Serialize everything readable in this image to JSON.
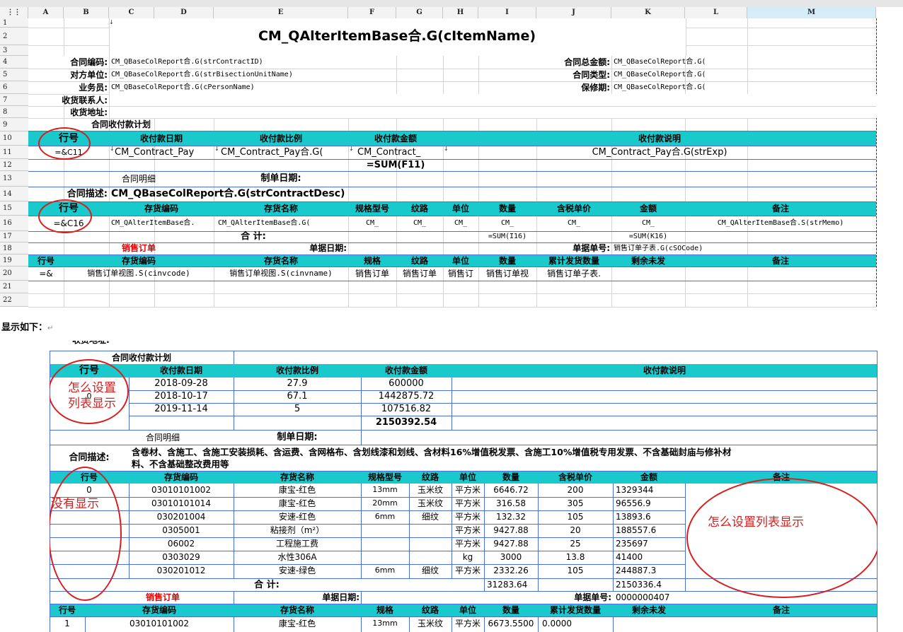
{
  "sheet": {
    "columns": [
      "A",
      "B",
      "C",
      "D",
      "E",
      "F",
      "G",
      "H",
      "I",
      "J",
      "K",
      "L",
      "M"
    ],
    "rows": [
      "1",
      "2",
      "3",
      "4",
      "5",
      "6",
      "7",
      "8",
      "9",
      "10",
      "11",
      "12",
      "13",
      "14",
      "15",
      "16",
      "17",
      "18",
      "19",
      "20",
      "21",
      "22"
    ],
    "title": "CM_QAlterItemBase合.G(cItemName)",
    "r4": {
      "label": "合同编码:",
      "value": "CM_QBaseColReport合.G(strContractID)",
      "label2": "合同总金额:",
      "value2": "CM_QBaseColReport合.G("
    },
    "r5": {
      "label": "对方单位:",
      "value": "CM_QBaseColReport合.G(strBisectionUnitName)",
      "label2": "合同类型:",
      "value2": "CM_QBaseColReport合.G("
    },
    "r6": {
      "label": "业务员:",
      "value": "CM_QBaseColReport合.G(cPersonName)",
      "label2": "保修期:",
      "value2": "CM_QBaseColReport合.G("
    },
    "r7": {
      "label": "收货联系人:"
    },
    "r8": {
      "label": "收货地址:"
    },
    "r9": {
      "label": "合同收付款计划"
    },
    "r10": {
      "c1": "行号",
      "c2": "收付款日期",
      "c3": "收付款比例",
      "c4": "收付款金额",
      "c5": "收付款说明"
    },
    "r11": {
      "c1": "=&C11",
      "c2": "CM_Contract_Pay",
      "c3": "CM_Contract_Pay合.G(",
      "c4": "CM_Contract_",
      "c5": "CM_Contract_Pay合.G(strExp)"
    },
    "r12": {
      "c4": "=SUM(F11)"
    },
    "r13": {
      "c1": "合同明细",
      "c2": "制单日期:"
    },
    "r14": {
      "label": "合同描述:",
      "value": "CM_QBaseColReport合.G(strContractDesc)"
    },
    "r15": {
      "cols": [
        "行号",
        "存货编码",
        "存货名称",
        "规格型号",
        "纹路",
        "单位",
        "数量",
        "含税单价",
        "金额",
        "备注"
      ]
    },
    "r16": {
      "c1": "=&C16",
      "c2": "CM_QAlterItemBase合.",
      "c3": "CM_QAlterItemBase合.G(",
      "c4": "CM_",
      "c5": "CM_",
      "c6": "CM_",
      "c7": "CM_",
      "c8": "CM_",
      "c9": "CM_",
      "c10": "CM_QAlterItemBase合.S(strMemo)"
    },
    "r17": {
      "label": "合 计:",
      "sum1": "=SUM(I16)",
      "sum2": "=SUM(K16)"
    },
    "r18": {
      "label": "销售订单",
      "label2": "单据日期:",
      "label3": "单据单号:",
      "value3": "销售订单子表.G(cSOCode)"
    },
    "r19": {
      "cols": [
        "行号",
        "存货编码",
        "存货名称",
        "规格",
        "纹路",
        "单位",
        "数量",
        "累计发货数量",
        "剩余未发",
        "备注"
      ]
    },
    "r20": {
      "c1": "=&",
      "c2": "销售订单视图.S(cinvcode)",
      "c3": "销售订单视图.S(cinvname)",
      "c4": "销售订单",
      "c5": "销售订单",
      "c6": "销售订",
      "c7": "销售订单视",
      "c8": "销售订单子表."
    }
  },
  "caption": "显示如下：",
  "caption_mark": "↵",
  "result": {
    "top_label": "收货地址:",
    "plan_title": "合同收付款计划",
    "plan_headers": [
      "行号",
      "收付款日期",
      "收付款比例",
      "收付款金额",
      "收付款说明"
    ],
    "plan_rows": [
      {
        "date": "2018-09-28",
        "ratio": "27.9",
        "amount": "600000"
      },
      {
        "date": "2018-10-17",
        "ratio": "67.1",
        "amount": "1442875.72"
      },
      {
        "date": "2019-11-14",
        "ratio": "5",
        "amount": "107516.82"
      }
    ],
    "plan_row_no": "0",
    "plan_total": "2150392.54",
    "detail_label": "合同明细",
    "detail_date_label": "制单日期:",
    "desc_label": "合同描述:",
    "desc_value_1": "含卷材、含施工、含施工安装损耗、含运费、含网格布、含划线漆和划线、含材料16%增值税发票、含施工10%增值税专用发票、不含基础封庙与修补材",
    "desc_value_2": "料、不含基础整改费用等",
    "items_headers": [
      "行号",
      "存货编码",
      "存货名称",
      "规格型号",
      "纹路",
      "单位",
      "数量",
      "含税单价",
      "金额",
      "备注"
    ],
    "items": [
      {
        "no": "0",
        "code": "03010101002",
        "name": "康宝-红色",
        "spec": "13mm",
        "grain": "玉米纹",
        "unit": "平方米",
        "qty": "6646.72",
        "price": "200",
        "amount": "1329344"
      },
      {
        "no": "",
        "code": "03010101014",
        "name": "康宝-红色",
        "spec": "20mm",
        "grain": "玉米纹",
        "unit": "平方米",
        "qty": "316.58",
        "price": "305",
        "amount": "96556.9"
      },
      {
        "no": "",
        "code": "030201004",
        "name": "安速-红色",
        "spec": "6mm",
        "grain": "细纹",
        "unit": "平方米",
        "qty": "132.32",
        "price": "105",
        "amount": "13893.6"
      },
      {
        "no": "",
        "code": "0305001",
        "name": "粘接剂（m²）",
        "spec": "",
        "grain": "",
        "unit": "平方米",
        "qty": "9427.88",
        "price": "20",
        "amount": "188557.6"
      },
      {
        "no": "",
        "code": "06002",
        "name": "工程施工费",
        "spec": "",
        "grain": "",
        "unit": "平方米",
        "qty": "9427.88",
        "price": "25",
        "amount": "235697"
      },
      {
        "no": "",
        "code": "0303029",
        "name": "水性306A",
        "spec": "",
        "grain": "",
        "unit": "kg",
        "qty": "3000",
        "price": "13.8",
        "amount": "41400"
      },
      {
        "no": "",
        "code": "030201012",
        "name": "安速-绿色",
        "spec": "6mm",
        "grain": "细纹",
        "unit": "平方米",
        "qty": "2332.26",
        "price": "105",
        "amount": "244887.3"
      }
    ],
    "sum_label": "合 计:",
    "sum_qty": "31283.64",
    "sum_amount": "2150336.4",
    "so_label": "销售订单",
    "so_date_label": "单据日期:",
    "so_no_label": "单据单号:",
    "so_no_value": "0000000407",
    "so_headers": [
      "行号",
      "存货编码",
      "存货名称",
      "规格",
      "纹路",
      "单位",
      "数量",
      "累计发货数量",
      "剩余未发",
      "备注"
    ],
    "so_row": {
      "no": "1",
      "code": "03010101002",
      "name": "康宝-红色",
      "spec": "13mm",
      "grain": "玉米纹",
      "unit": "平方米",
      "qty": "6673.5500",
      "shipped": "0.0000"
    },
    "note1_line1": "怎么设置",
    "note1_line2": "列表显示",
    "note2": "没有显示",
    "note3": "怎么设置列表显示"
  },
  "colors": {
    "teal": "#19c9cc",
    "red": "#d81e1e",
    "grid": "#d4d4d4",
    "blue_border": "#4a6fd6"
  }
}
